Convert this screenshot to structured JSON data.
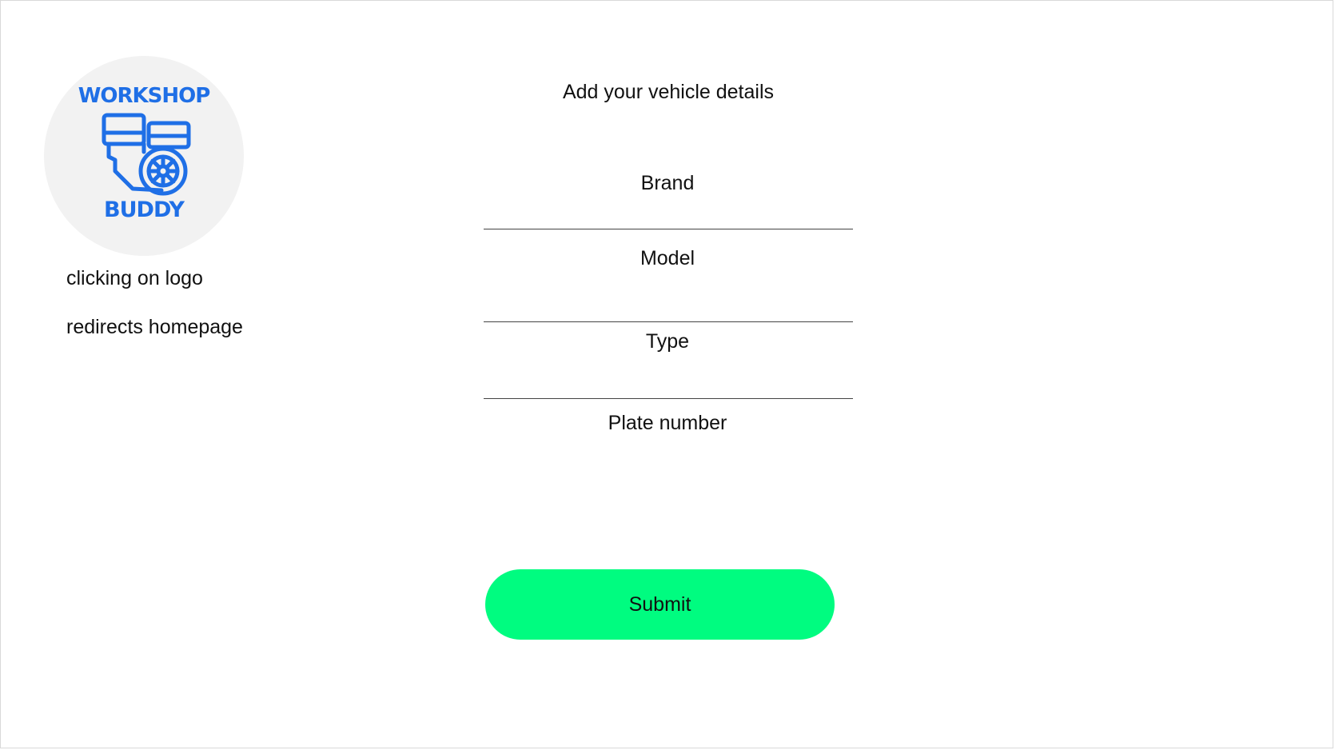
{
  "logo": {
    "word_top": "WORKSHOP",
    "word_bottom": "BUDDY",
    "icon": "engine-icon",
    "color": "#1f6fe6",
    "background": "#f2f2f2"
  },
  "note": {
    "line1": "clicking on logo",
    "line2": "redirects homepage"
  },
  "form": {
    "title": "Add your vehicle details",
    "fields": [
      {
        "label": "Brand",
        "value": ""
      },
      {
        "label": "Model",
        "value": ""
      },
      {
        "label": "Type",
        "value": ""
      },
      {
        "label": "Plate number",
        "value": ""
      }
    ],
    "submit_label": "Submit",
    "submit_color": "#00fc80"
  }
}
